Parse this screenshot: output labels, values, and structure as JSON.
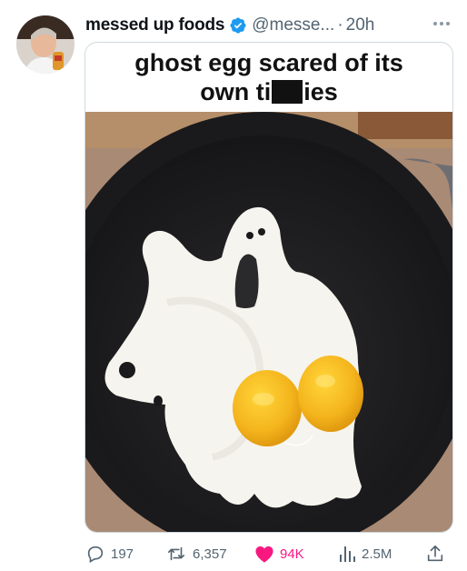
{
  "tweet": {
    "author": {
      "display_name": "messed up foods",
      "handle": "@messe...",
      "separator": "·",
      "time": "20h"
    },
    "caption_line1": "ghost egg scared of its",
    "caption_line2_before": "own ti",
    "caption_line2_after": "ies"
  },
  "actions": {
    "replies": "197",
    "retweets": "6,357",
    "likes": "94K",
    "views": "2.5M"
  },
  "colors": {
    "verified": "#1d9bf0",
    "like": "#f91880",
    "secondary_text": "#536471"
  },
  "icons": [
    "verified-badge-icon",
    "more-icon",
    "reply-icon",
    "retweet-icon",
    "heart-icon",
    "views-icon",
    "share-icon"
  ]
}
